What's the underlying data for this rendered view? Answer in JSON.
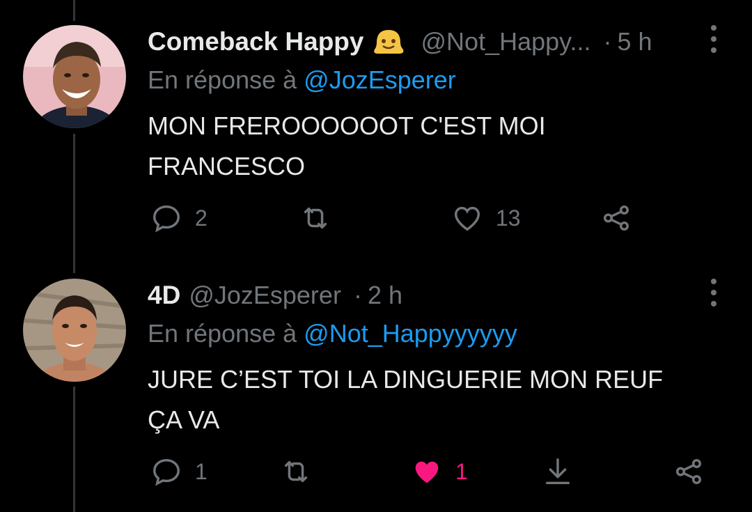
{
  "tweets": [
    {
      "name": "Comeback Happy",
      "handle": "@Not_Happy...",
      "separator": "·",
      "time": "5 h",
      "reply_prefix": "En réponse à",
      "reply_to": "@JozEsperer",
      "text_line1": "MON FREROOOOOOT C'EST MOI",
      "text_line2": "FRANCESCO",
      "replies": "2",
      "likes": "13",
      "liked": false,
      "emoji": "melting-face-emoji"
    },
    {
      "name": "4D",
      "handle": "@JozEsperer",
      "separator": "·",
      "time": "2 h",
      "reply_prefix": "En réponse à",
      "reply_to": "@Not_Happyyyyyy",
      "text_line1": "JURE C’EST TOI LA DINGUERIE MON REUF",
      "text_line2": "ÇA VA",
      "replies": "1",
      "likes": "1",
      "liked": true
    }
  ],
  "colors": {
    "background": "#000000",
    "text": "#e7e9ea",
    "muted": "#71767b",
    "link": "#1d9bf0",
    "like": "#f91880"
  },
  "icons": [
    "reply-icon",
    "retweet-icon",
    "like-icon",
    "share-icon",
    "download-icon",
    "more-icon"
  ]
}
